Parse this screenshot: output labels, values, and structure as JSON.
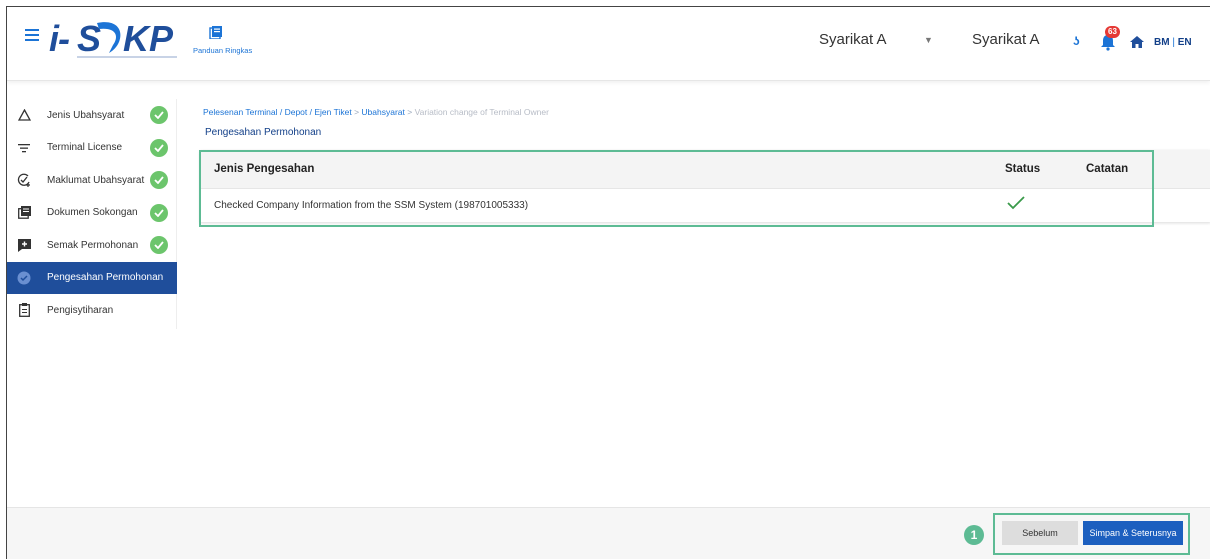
{
  "header": {
    "logo_text": "i-SPKP",
    "guide_label": "Panduan Ringkas",
    "company_select": "Syarikat A",
    "company_name": "Syarikat A",
    "notification_count": "63",
    "lang_bm": "BM",
    "lang_sep": "|",
    "lang_en": "EN"
  },
  "sidebar": {
    "items": [
      {
        "label": "Jenis Ubahsyarat",
        "icon": "triangle-icon",
        "completed": true
      },
      {
        "label": "Terminal License",
        "icon": "filter-icon",
        "completed": true
      },
      {
        "label": "Maklumat Ubahsyarat",
        "icon": "edit-check-icon",
        "completed": true
      },
      {
        "label": "Dokumen Sokongan",
        "icon": "documents-icon",
        "completed": true
      },
      {
        "label": "Semak Permohonan",
        "icon": "review-icon",
        "completed": true
      },
      {
        "label": "Pengesahan Permohonan",
        "icon": "verify-icon",
        "active": true
      },
      {
        "label": "Pengisytiharan",
        "icon": "clipboard-icon"
      }
    ]
  },
  "breadcrumb": {
    "part1": "Pelesenan Terminal / Depot / Ejen Tiket",
    "sep": ">",
    "part2": "Ubahsyarat",
    "part3": "Variation change of Terminal Owner"
  },
  "page_title": "Pengesahan Permohonan",
  "table": {
    "headers": {
      "type": "Jenis Pengesahan",
      "status": "Status",
      "notes": "Catatan"
    },
    "rows": [
      {
        "type": "Checked Company Information from the SSM System (198701005333)",
        "status": "check-icon",
        "notes": ""
      }
    ]
  },
  "footer": {
    "step": "1",
    "prev_label": "Sebelum",
    "next_label": "Simpan & Seterusnya"
  },
  "colors": {
    "primary": "#1c74d6",
    "active_nav": "#1f4e9b",
    "success": "#6cc56c",
    "highlight": "#5dbb94",
    "danger": "#e53935"
  }
}
